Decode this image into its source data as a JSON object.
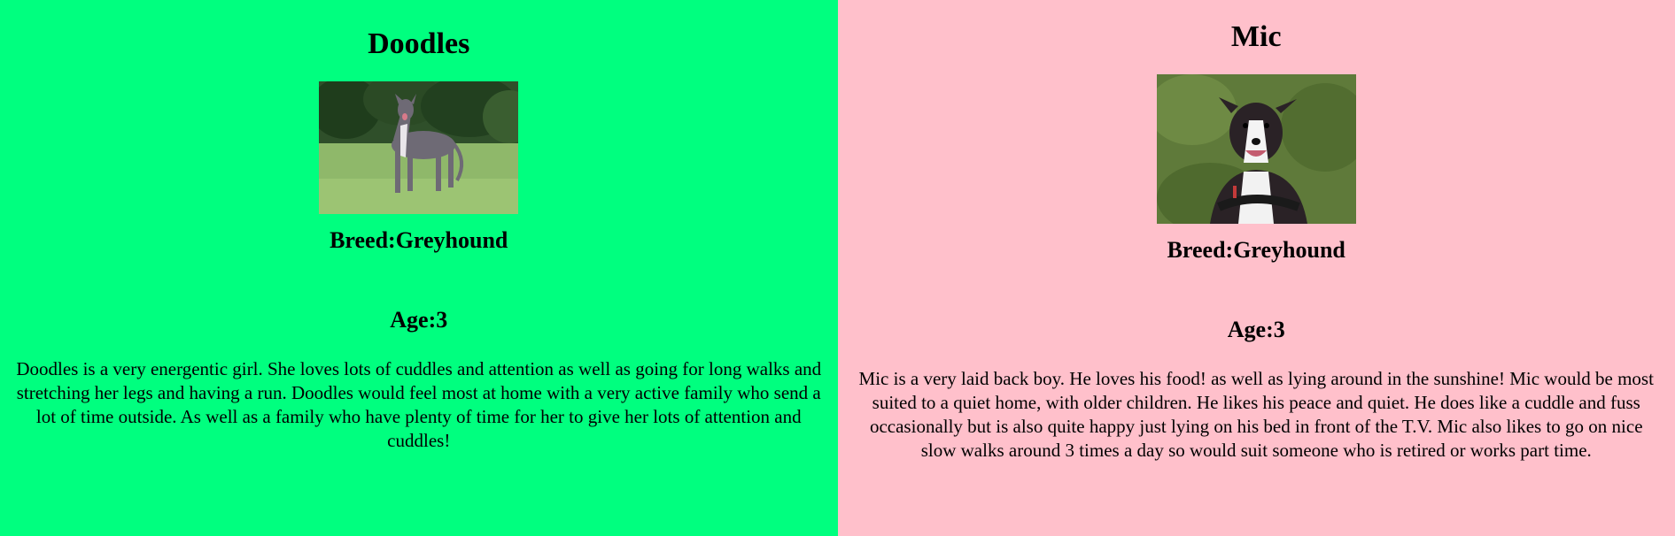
{
  "dogs": [
    {
      "name": "Doodles",
      "breed": "Breed:Greyhound",
      "age": "Age:3",
      "bio": "Doodles is a very energentic girl. She loves lots of cuddles and attention as well as going for long walks and stretching her legs and having a run. Doodles would feel most at home with a very active family who send a lot of time outside. As well as a family who have plenty of time for her to give her lots of attention and cuddles!",
      "background": "#00ff7f",
      "photo_icon": "dog-photo-grey-greyhound-in-field"
    },
    {
      "name": "Mic",
      "breed": "Breed:Greyhound",
      "age": "Age:3",
      "bio": "Mic is a very laid back boy. He loves his food! as well as lying around in the sunshine! Mic would be most suited to a quiet home, with older children. He likes his peace and quiet. He does like a cuddle and fuss occasionally but is also quite happy just lying on his bed in front of the T.V. Mic also likes to go on nice slow walks around 3 times a day so would suit someone who is retired or works part time.",
      "background": "#ffc0cb",
      "photo_icon": "dog-photo-black-white-whippet-on-grass"
    }
  ]
}
